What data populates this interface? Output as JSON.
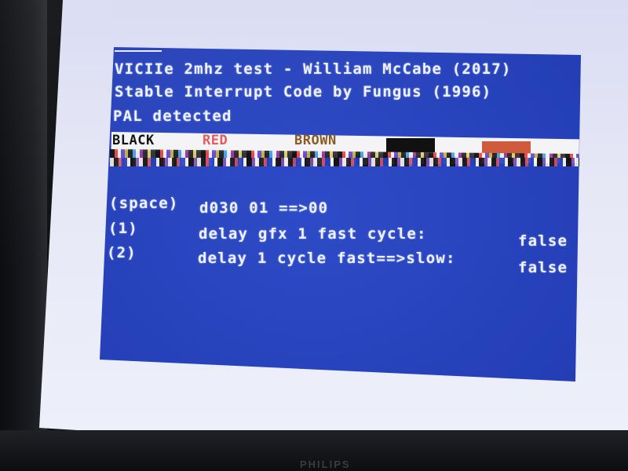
{
  "monitor": {
    "brand": "PHILIPS"
  },
  "screen": {
    "header_lines": [
      "VICIIe 2mhz test - William McCabe (2017)",
      "Stable Interrupt Code by Fungus (1996)",
      "PAL detected"
    ],
    "color_labels": {
      "black": "BLACK",
      "red": "RED",
      "brown": "BROWN"
    },
    "menu": [
      {
        "key": "(space)",
        "text": "d030 01 ==>00",
        "value": ""
      },
      {
        "key": "(1)",
        "text": "delay gfx 1 fast cycle:",
        "value": "false"
      },
      {
        "key": "(2)",
        "text": "delay 1 cycle fast==>slow:",
        "value": "false"
      }
    ]
  },
  "colors": {
    "screen_blue": "#2341c4",
    "text": "#eef1ff",
    "red_label": "#e25a5a",
    "brown_label": "#8a5a20",
    "swatch_black": "#111111",
    "swatch_red": "#d05a3c"
  }
}
